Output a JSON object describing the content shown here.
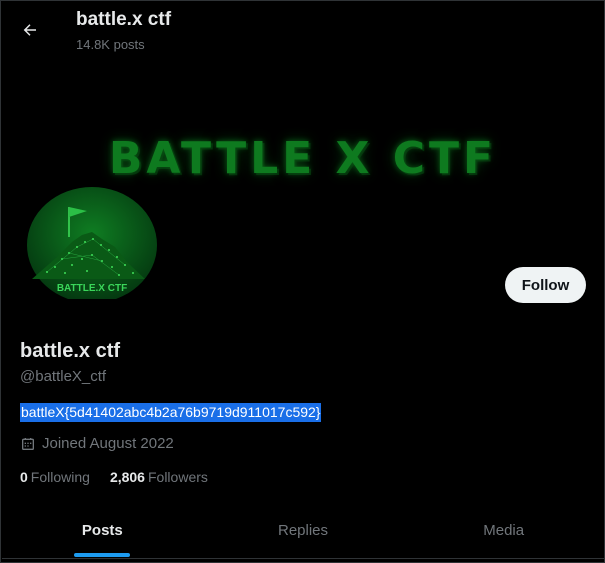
{
  "header": {
    "back_icon": "arrow-left-icon",
    "title": "battle.x ctf",
    "post_count": "14.8K posts"
  },
  "banner": {
    "text": "BATTLE X CTF",
    "color": "#0e7a1f"
  },
  "avatar": {
    "caption": "BATTLE.X CTF",
    "color": "#0b6b1c"
  },
  "profile": {
    "follow_label": "Follow",
    "display_name": "battle.x ctf",
    "handle": "@battleX_ctf",
    "bio": "battleX{5d41402abc4b2a76b9719d911017c592}",
    "joined_icon": "calendar-icon",
    "joined": "Joined August 2022",
    "following_count": "0",
    "following_label": "Following",
    "followers_count": "2,806",
    "followers_label": "Followers"
  },
  "tabs": [
    {
      "label": "Posts",
      "active": true
    },
    {
      "label": "Replies",
      "active": false
    },
    {
      "label": "Media",
      "active": false
    }
  ],
  "colors": {
    "accent": "#1d9bf0",
    "selection": "#1a6fe8",
    "muted_text": "#71767b"
  }
}
